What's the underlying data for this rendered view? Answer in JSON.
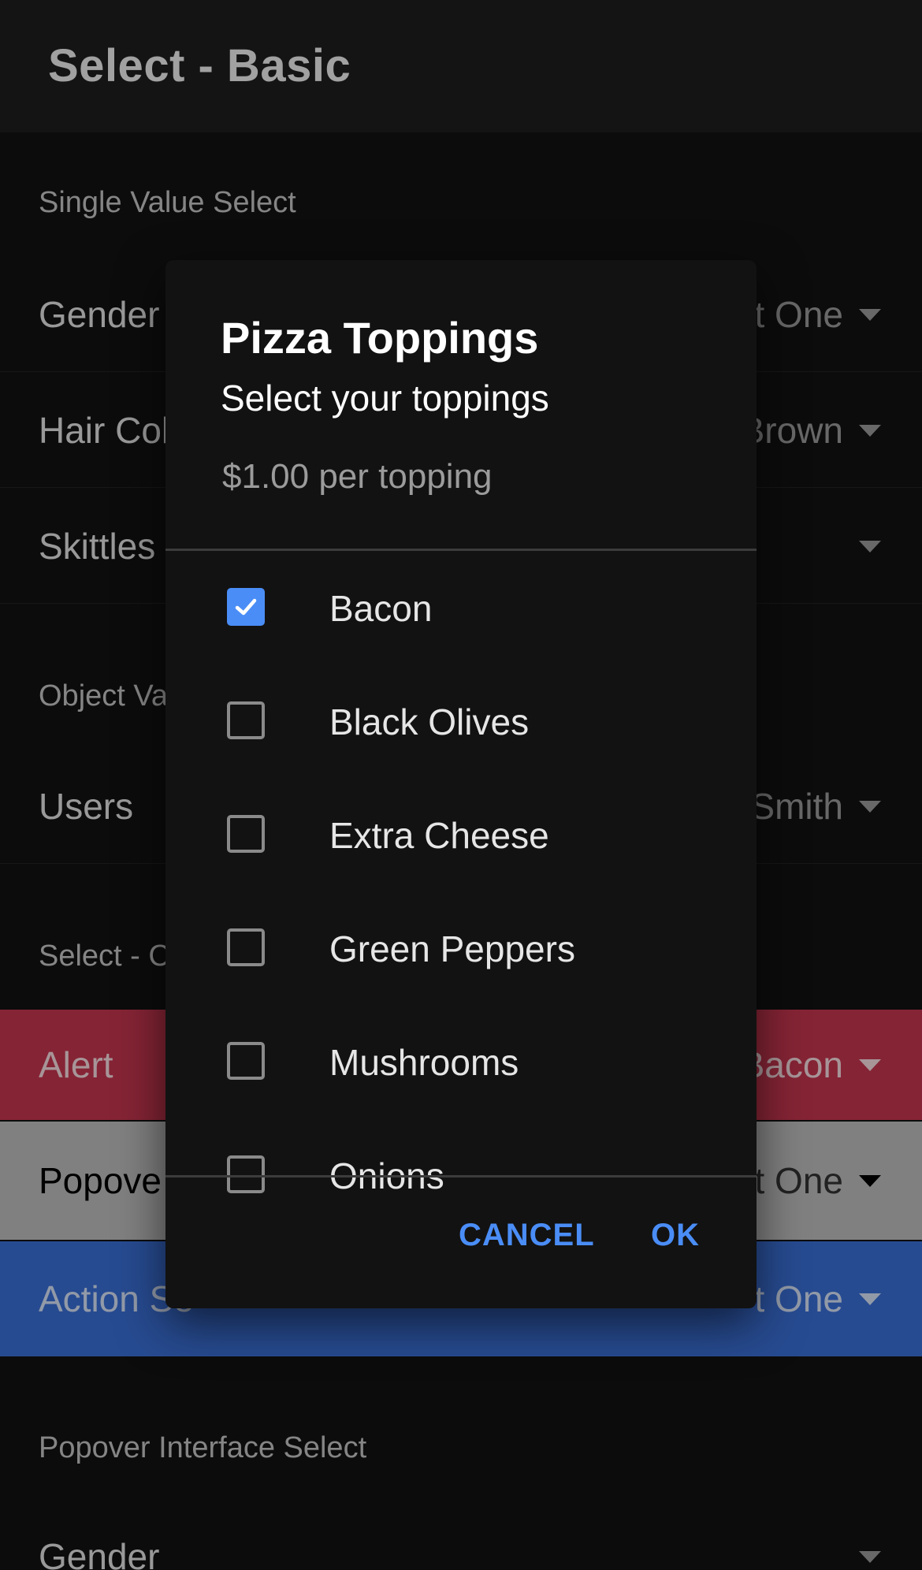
{
  "toolbar": {
    "title": "Select - Basic"
  },
  "sections": {
    "single": "Single Value Select",
    "object": "Object Va",
    "custom": "Select - C",
    "popover": "Popover Interface Select"
  },
  "items": {
    "gender": {
      "label": "Gender",
      "value": "t One"
    },
    "hair": {
      "label": "Hair Col",
      "value": "Brown"
    },
    "skittles": {
      "label": "Skittles",
      "value": ""
    },
    "users": {
      "label": "Users",
      "value": "Smith"
    },
    "alert": {
      "label": "Alert",
      "value": "Bacon"
    },
    "popover": {
      "label": "Popove",
      "value": "t One"
    },
    "action": {
      "label": "Action Se",
      "value": "t One"
    },
    "popover_gender": {
      "label": "Gender",
      "value": ""
    }
  },
  "dialog": {
    "title": "Pizza Toppings",
    "subtitle": "Select your toppings",
    "message": "$1.00 per topping",
    "options": [
      {
        "label": "Bacon",
        "checked": true
      },
      {
        "label": "Black Olives",
        "checked": false
      },
      {
        "label": "Extra Cheese",
        "checked": false
      },
      {
        "label": "Green Peppers",
        "checked": false
      },
      {
        "label": "Mushrooms",
        "checked": false
      },
      {
        "label": "Onions",
        "checked": false
      }
    ],
    "cancel_label": "CANCEL",
    "ok_label": "OK"
  },
  "colors": {
    "accent": "#4a8df6",
    "alert_row": "#c5364f",
    "popover_row": "#bdbdbd",
    "action_row": "#3a6fd6"
  },
  "icons": {
    "caret": "caret-down-icon",
    "check": "check-icon"
  }
}
